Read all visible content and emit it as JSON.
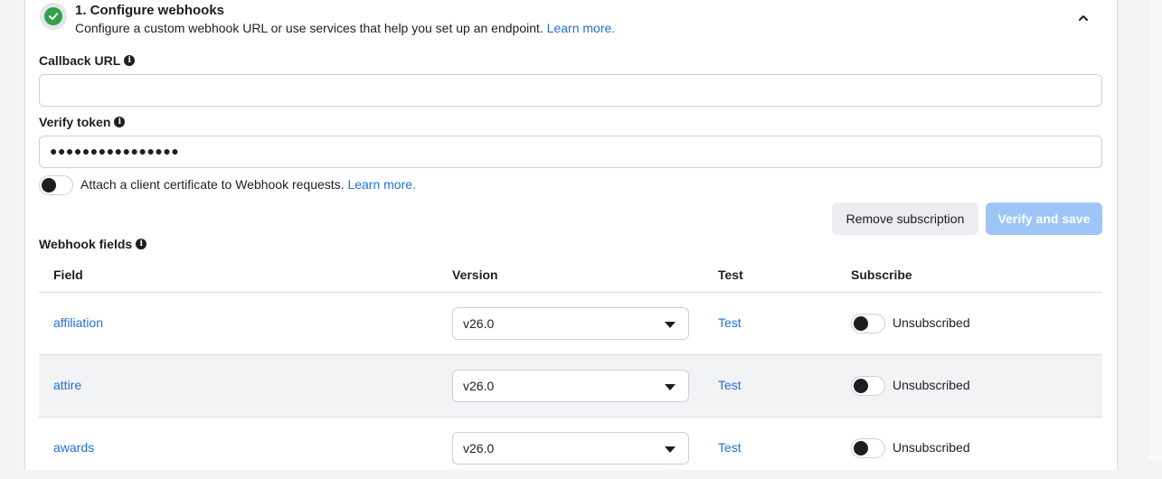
{
  "section": {
    "title": "1. Configure webhooks",
    "description": "Configure a custom webhook URL or use services that help you set up an endpoint.",
    "learn_more": "Learn more."
  },
  "callback_url": {
    "label": "Callback URL",
    "value": ""
  },
  "verify_token": {
    "label": "Verify token",
    "masked_value": "●●●●●●●●●●●●●●●●"
  },
  "certificate": {
    "text": "Attach a client certificate to Webhook requests.",
    "learn_more": "Learn more.",
    "enabled": false
  },
  "buttons": {
    "remove": "Remove subscription",
    "verify": "Verify and save"
  },
  "webhook_fields": {
    "label": "Webhook fields",
    "columns": {
      "field": "Field",
      "version": "Version",
      "test": "Test",
      "subscribe": "Subscribe"
    },
    "rows": [
      {
        "field": "affiliation",
        "version": "v26.0",
        "test": "Test",
        "status": "Unsubscribed"
      },
      {
        "field": "attire",
        "version": "v26.0",
        "test": "Test",
        "status": "Unsubscribed"
      },
      {
        "field": "awards",
        "version": "v26.0",
        "test": "Test",
        "status": "Unsubscribed"
      }
    ]
  },
  "icons": [
    "check-circle-icon",
    "chevron-up-icon",
    "info-icon",
    "caret-down-icon"
  ],
  "colors": {
    "link": "#216fdb",
    "success": "#31a24c",
    "primary_disabled": "#9ec5f7"
  }
}
